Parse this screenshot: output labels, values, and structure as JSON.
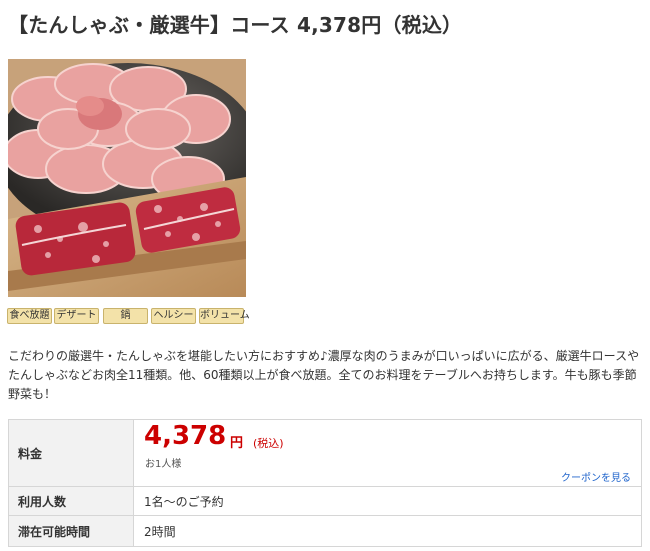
{
  "course": {
    "title": "【たんしゃぶ・厳選牛】コース 4,378円（税込）",
    "photo_alt": "tongue-and-beef-platter-photo"
  },
  "tags": [
    "食べ放題",
    "デザート",
    "鍋",
    "ヘルシー",
    "ボリューム"
  ],
  "description": "こだわりの厳選牛・たんしゃぶを堪能したい方におすすめ♪濃厚な肉のうまみが口いっぱいに広がる、厳選牛ロースやたんしゃぶなどお肉全11種類。他、60種類以上が食べ放題。全てのお料理をテーブルへお持ちします。牛も豚も季節野菜も！",
  "info": {
    "price_label": "料金",
    "price_value": "4,378",
    "price_unit": "円",
    "price_tax": "(税込)",
    "price_per": "お1人様",
    "coupon_link": "クーポンを見る",
    "people_label": "利用人数",
    "people_value": "1名～のご予約",
    "stay_label": "滞在可能時間",
    "stay_value": "2時間"
  },
  "colors": {
    "price": "#cc0000",
    "link": "#2266cc",
    "tag_bg": "#f3e2a9",
    "table_header_bg": "#f2f2f2"
  }
}
